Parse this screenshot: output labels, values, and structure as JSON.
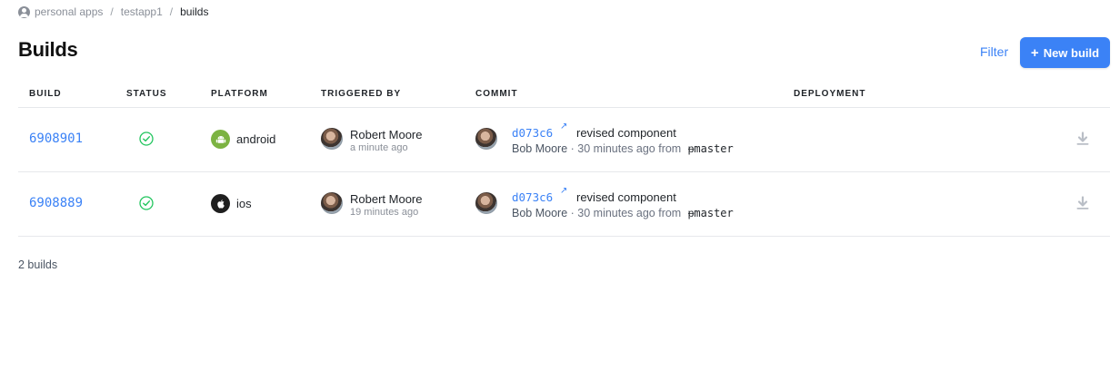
{
  "breadcrumb": {
    "items": [
      "personal apps",
      "testapp1",
      "builds"
    ],
    "separator": "/"
  },
  "header": {
    "title": "Builds",
    "filter_label": "Filter",
    "new_build_label": "New build",
    "new_build_icon": "+"
  },
  "table": {
    "columns": [
      "BUILD",
      "STATUS",
      "PLATFORM",
      "TRIGGERED BY",
      "COMMIT",
      "DEPLOYMENT"
    ],
    "rows": [
      {
        "build_id": "6908901",
        "status_icon": "check-circle-icon",
        "platform": "android",
        "platform_icon": "android-icon",
        "triggered_by": "Robert Moore",
        "triggered_time": "a minute ago",
        "commit_hash": "d073c6",
        "commit_link_icon": "↗",
        "commit_message": "revised component",
        "commit_author": "Bob Moore",
        "commit_time": "· 30 minutes ago from",
        "branch_icon": "ᵽ",
        "branch": "master",
        "action_icon": "download-icon"
      },
      {
        "build_id": "6908889",
        "status_icon": "check-circle-icon",
        "platform": "ios",
        "platform_icon": "apple-icon",
        "triggered_by": "Robert Moore",
        "triggered_time": "19 minutes ago",
        "commit_hash": "d073c6",
        "commit_link_icon": "↗",
        "commit_message": "revised component",
        "commit_author": "Bob Moore",
        "commit_time": "· 30 minutes ago from",
        "branch_icon": "ᵽ",
        "branch": "master",
        "action_icon": "download-icon"
      }
    ]
  },
  "footer": {
    "count_label": "2 builds"
  },
  "colors": {
    "accent": "#3b82f6",
    "success": "#22c55e",
    "android": "#7cb342",
    "ios": "#1f1f1f",
    "divider": "#e6e8eb"
  }
}
